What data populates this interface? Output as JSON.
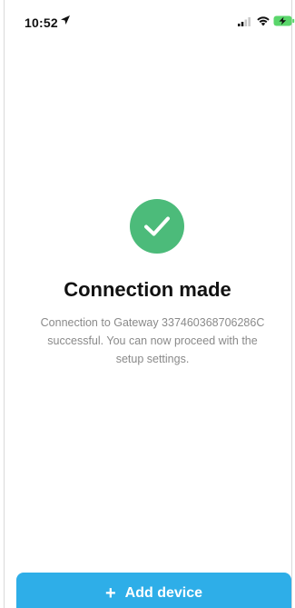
{
  "status_bar": {
    "time": "10:52",
    "icons": [
      "location-arrow-icon",
      "signal-icon",
      "wifi-icon",
      "battery-charging-icon"
    ]
  },
  "success": {
    "icon": "checkmark-icon",
    "color": "#4cbb7a"
  },
  "title": "Connection made",
  "message": "Connection to Gateway 337460368706286C successful. You can now proceed with the setup settings.",
  "actions": {
    "add_device_label": "Add device",
    "add_device_icon": "+",
    "button_color": "#2eaee8"
  }
}
